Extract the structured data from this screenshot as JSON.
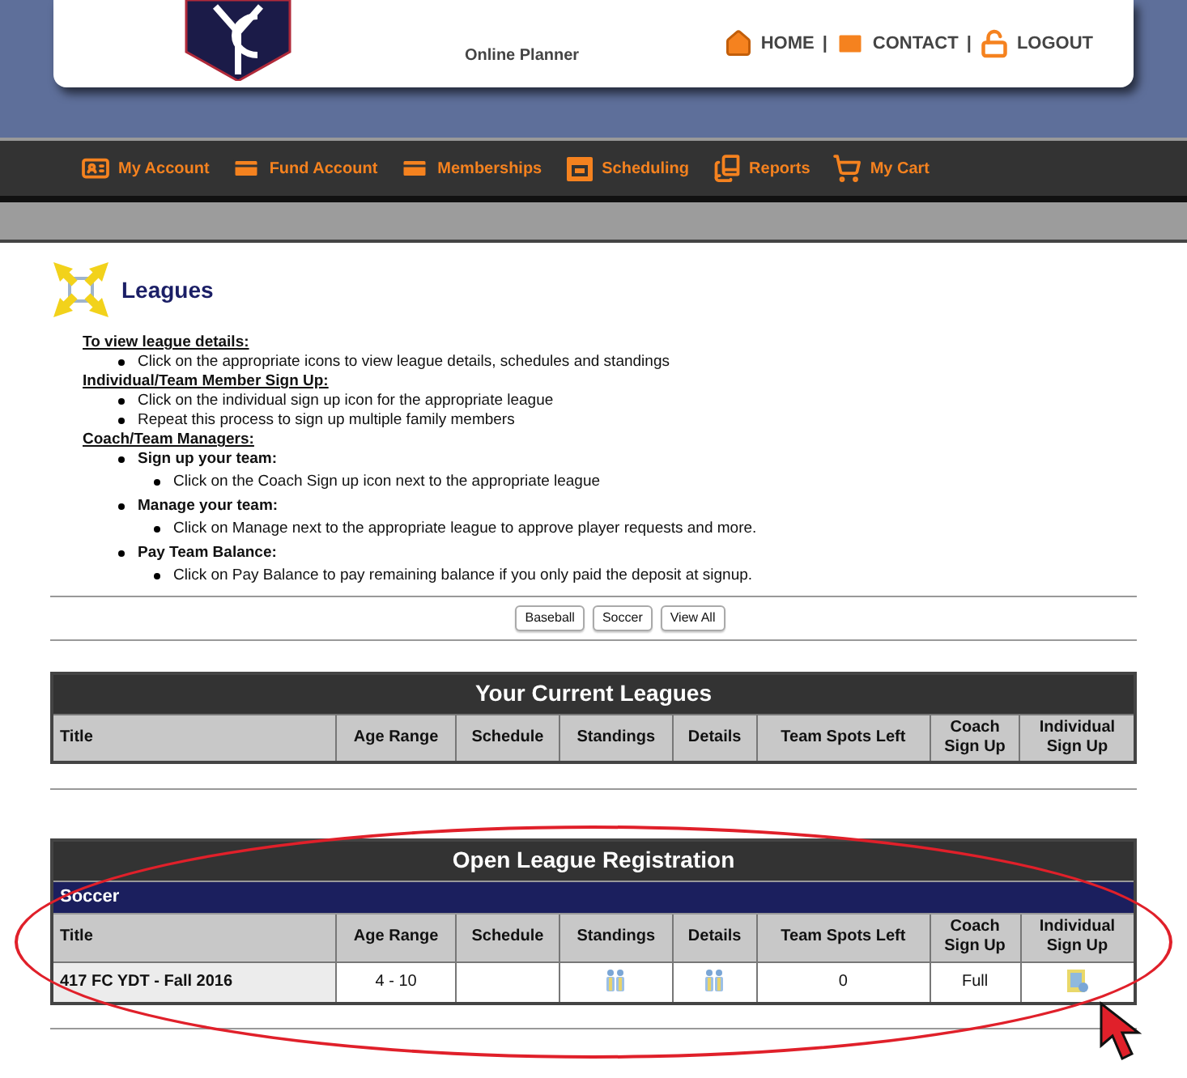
{
  "header": {
    "subtitle": "Online Planner",
    "links": [
      {
        "label": "HOME",
        "kind": "home"
      },
      {
        "label": "CONTACT",
        "kind": "mail"
      },
      {
        "label": "LOGOUT",
        "kind": "lock"
      }
    ],
    "separator": "|"
  },
  "nav": [
    {
      "label": "My Account",
      "kind": "account"
    },
    {
      "label": "Fund Account",
      "kind": "card"
    },
    {
      "label": "Memberships",
      "kind": "card"
    },
    {
      "label": "Scheduling",
      "kind": "calendar"
    },
    {
      "label": "Reports",
      "kind": "books"
    },
    {
      "label": "My Cart",
      "kind": "cart"
    }
  ],
  "page_title": "Leagues",
  "instructions": [
    {
      "heading": "To view league details:",
      "items": [
        {
          "text": "Click on the appropriate icons to view league details, schedules and standings"
        }
      ]
    },
    {
      "heading": "Individual/Team Member Sign Up:",
      "items": [
        {
          "text": "Click on the individual sign up icon for the appropriate league"
        },
        {
          "text": "Repeat this process to sign up multiple family members"
        }
      ]
    },
    {
      "heading": "Coach/Team Managers:",
      "items": [
        {
          "text": "Sign up your team:",
          "children": [
            {
              "text": "Click on the Coach Sign up icon next to the appropriate league"
            }
          ]
        },
        {
          "text": "Manage your team:",
          "children": [
            {
              "text": "Click on Manage next to the appropriate league to approve player requests and more."
            }
          ]
        },
        {
          "text": "Pay Team Balance:",
          "children": [
            {
              "text": "Click on Pay Balance to pay remaining balance if you only paid the deposit at signup."
            }
          ]
        }
      ]
    }
  ],
  "filters": [
    "Baseball",
    "Soccer",
    "View All"
  ],
  "current_leagues": {
    "title": "Your Current Leagues",
    "columns": [
      "Title",
      "Age Range",
      "Schedule",
      "Standings",
      "Details",
      "Team Spots Left",
      "Coach Sign Up",
      "Individual Sign Up"
    ]
  },
  "open_registration": {
    "title": "Open League Registration",
    "group": "Soccer",
    "columns": [
      "Title",
      "Age Range",
      "Schedule",
      "Standings",
      "Details",
      "Team Spots Left",
      "Coach Sign Up",
      "Individual Sign Up"
    ],
    "rows": [
      {
        "cells": [
          {
            "kind": "title",
            "text": "417 FC YDT - Fall 2016"
          },
          {
            "kind": "text",
            "text": "4 - 10"
          },
          {
            "kind": "empty"
          },
          {
            "kind": "standings"
          },
          {
            "kind": "details"
          },
          {
            "kind": "text",
            "text": "0"
          },
          {
            "kind": "text",
            "text": "Full"
          },
          {
            "kind": "signup"
          }
        ]
      }
    ]
  }
}
